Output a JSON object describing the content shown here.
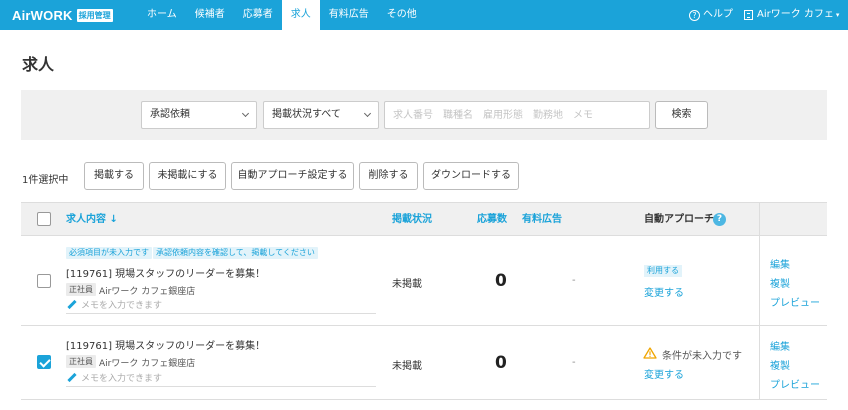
{
  "header": {
    "logo": "AirWORK",
    "logo_badge": "採用管理",
    "nav": [
      {
        "label": "ホーム"
      },
      {
        "label": "候補者"
      },
      {
        "label": "応募者"
      },
      {
        "label": "求人"
      },
      {
        "label": "有料広告"
      },
      {
        "label": "その他"
      }
    ],
    "active_nav": "求人",
    "help_label": "ヘルプ",
    "account_label": "Airワーク カフェ"
  },
  "page_title": "求人",
  "search": {
    "approval_select": "承認依頼",
    "status_select": "掲載状況すべて",
    "keyword_placeholder": "求人番号　職種名　雇用形態　勤務地　メモ",
    "search_button": "検索"
  },
  "bulk": {
    "selected_text": "1件選択中",
    "buttons": [
      "掲載する",
      "未掲載にする",
      "自動アプローチ設定する",
      "削除する",
      "ダウンロードする"
    ]
  },
  "table": {
    "headers": {
      "content": "求人内容 ↓",
      "status": "掲載状況",
      "applicants": "応募数",
      "paid_ad": "有料広告",
      "auto_approach": "自動アプローチ"
    },
    "rows": [
      {
        "checked": false,
        "tags": [
          "必須項目が未入力です",
          "承認依頼内容を確認して、掲載してください"
        ],
        "title": "[119761] 現場スタッフのリーダーを募集！",
        "employment": "正社員",
        "store": "Airワーク カフェ銀座店",
        "memo_placeholder": "メモを入力できます",
        "status": "未掲載",
        "applicants": "0",
        "paid_ad": "-",
        "auto_status": "利用する",
        "auto_link": "変更する",
        "actions": [
          "編集",
          "複製",
          "プレビュー"
        ]
      },
      {
        "checked": true,
        "title": "[119761] 現場スタッフのリーダーを募集！",
        "employment": "正社員",
        "store": "Airワーク カフェ銀座店",
        "memo_placeholder": "メモを入力できます",
        "status": "未掲載",
        "applicants": "0",
        "paid_ad": "-",
        "auto_warning": "条件が未入力です",
        "auto_link": "変更する",
        "actions": [
          "編集",
          "複製",
          "プレビュー"
        ]
      }
    ]
  },
  "colors": {
    "accent": "#1ba3d9",
    "warning": "#f0a500"
  }
}
